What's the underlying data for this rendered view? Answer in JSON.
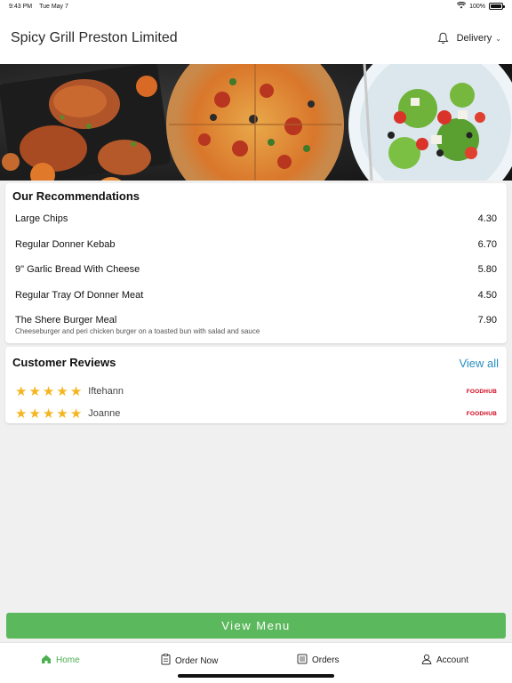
{
  "status_bar": {
    "time": "9:43 PM",
    "date": "Tue May 7",
    "battery": "100%",
    "battery_level": 1.0
  },
  "header": {
    "title": "Spicy Grill Preston Limited",
    "delivery_label": "Delivery"
  },
  "recommendations": {
    "title": "Our Recommendations",
    "items": [
      {
        "name": "Large Chips",
        "price": "4.30",
        "description": ""
      },
      {
        "name": "Regular Donner Kebab",
        "price": "6.70",
        "description": ""
      },
      {
        "name": "9\" Garlic Bread With Cheese",
        "price": "5.80",
        "description": ""
      },
      {
        "name": "Regular Tray Of Donner Meat",
        "price": "4.50",
        "description": ""
      },
      {
        "name": "The Shere Burger Meal",
        "price": "7.90",
        "description": "Cheeseburger and peri chicken burger on a toasted bun with salad and sauce"
      }
    ]
  },
  "reviews": {
    "title": "Customer Reviews",
    "view_all": "View all",
    "items": [
      {
        "name": "Iftehann",
        "rating": 5,
        "source": "FOODHUB"
      },
      {
        "name": "Joanne",
        "rating": 5,
        "source": "FOODHUB"
      }
    ]
  },
  "view_menu_label": "View Menu",
  "tabs": [
    {
      "label": "Home",
      "icon": "home-icon",
      "active": true
    },
    {
      "label": "Order Now",
      "icon": "order-icon",
      "active": false
    },
    {
      "label": "Orders",
      "icon": "orders-list-icon",
      "active": false
    },
    {
      "label": "Account",
      "icon": "person-icon",
      "active": false
    }
  ],
  "colors": {
    "accent_green": "#5cb85c",
    "link_blue": "#2a8fc2",
    "star": "#f5b51f",
    "brand_red": "#d0021b"
  }
}
